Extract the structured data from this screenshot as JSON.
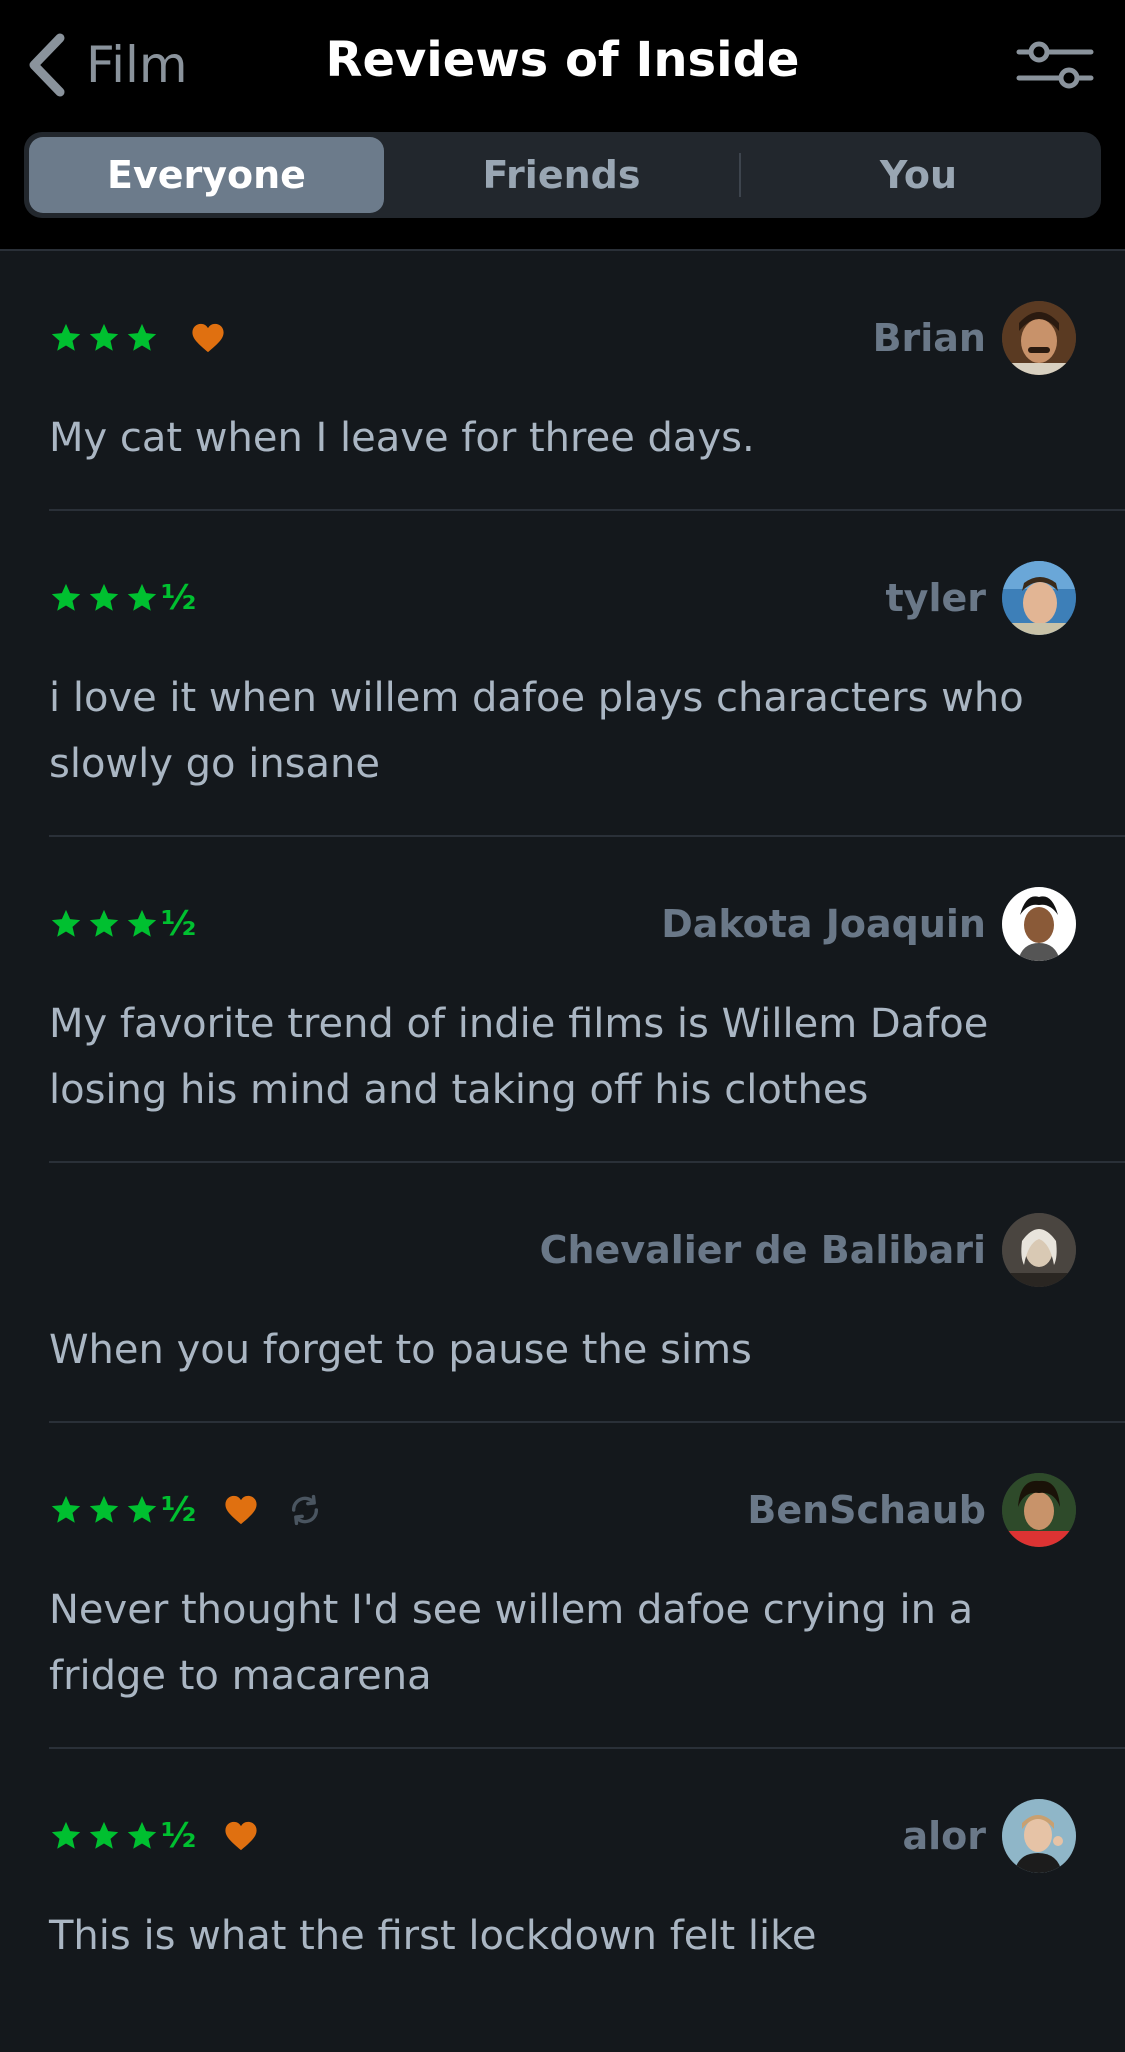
{
  "header": {
    "back_label": "Film",
    "title": "Reviews of Inside",
    "filter_icon": "sliders-icon"
  },
  "tabs": [
    {
      "label": "Everyone",
      "active": true
    },
    {
      "label": "Friends",
      "active": false
    },
    {
      "label": "You",
      "active": false
    }
  ],
  "colors": {
    "star": "#00c030",
    "heart": "#e07010",
    "active_tab": "#6c7b8b",
    "background": "#14181c"
  },
  "reviews": [
    {
      "author": "Brian",
      "rating": 3,
      "liked": true,
      "rewatch": false,
      "text": "My cat when I leave for three days."
    },
    {
      "author": "tyler",
      "rating": 3.5,
      "liked": false,
      "rewatch": false,
      "text": "i love it when willem dafoe plays characters who slowly go insane"
    },
    {
      "author": "Dakota Joaquin",
      "rating": 3.5,
      "liked": false,
      "rewatch": false,
      "text": "My favorite trend of indie films is Willem Dafoe losing his mind and taking off his clothes"
    },
    {
      "author": "Chevalier de Balibari",
      "rating": null,
      "liked": false,
      "rewatch": false,
      "text": "When you forget to pause the sims"
    },
    {
      "author": "BenSchaub",
      "rating": 3.5,
      "liked": true,
      "rewatch": true,
      "text": "Never thought I'd see willem dafoe crying in a fridge to macarena"
    },
    {
      "author": "alor",
      "rating": 3.5,
      "liked": true,
      "rewatch": false,
      "text": "This is what the first lockdown felt like"
    }
  ]
}
